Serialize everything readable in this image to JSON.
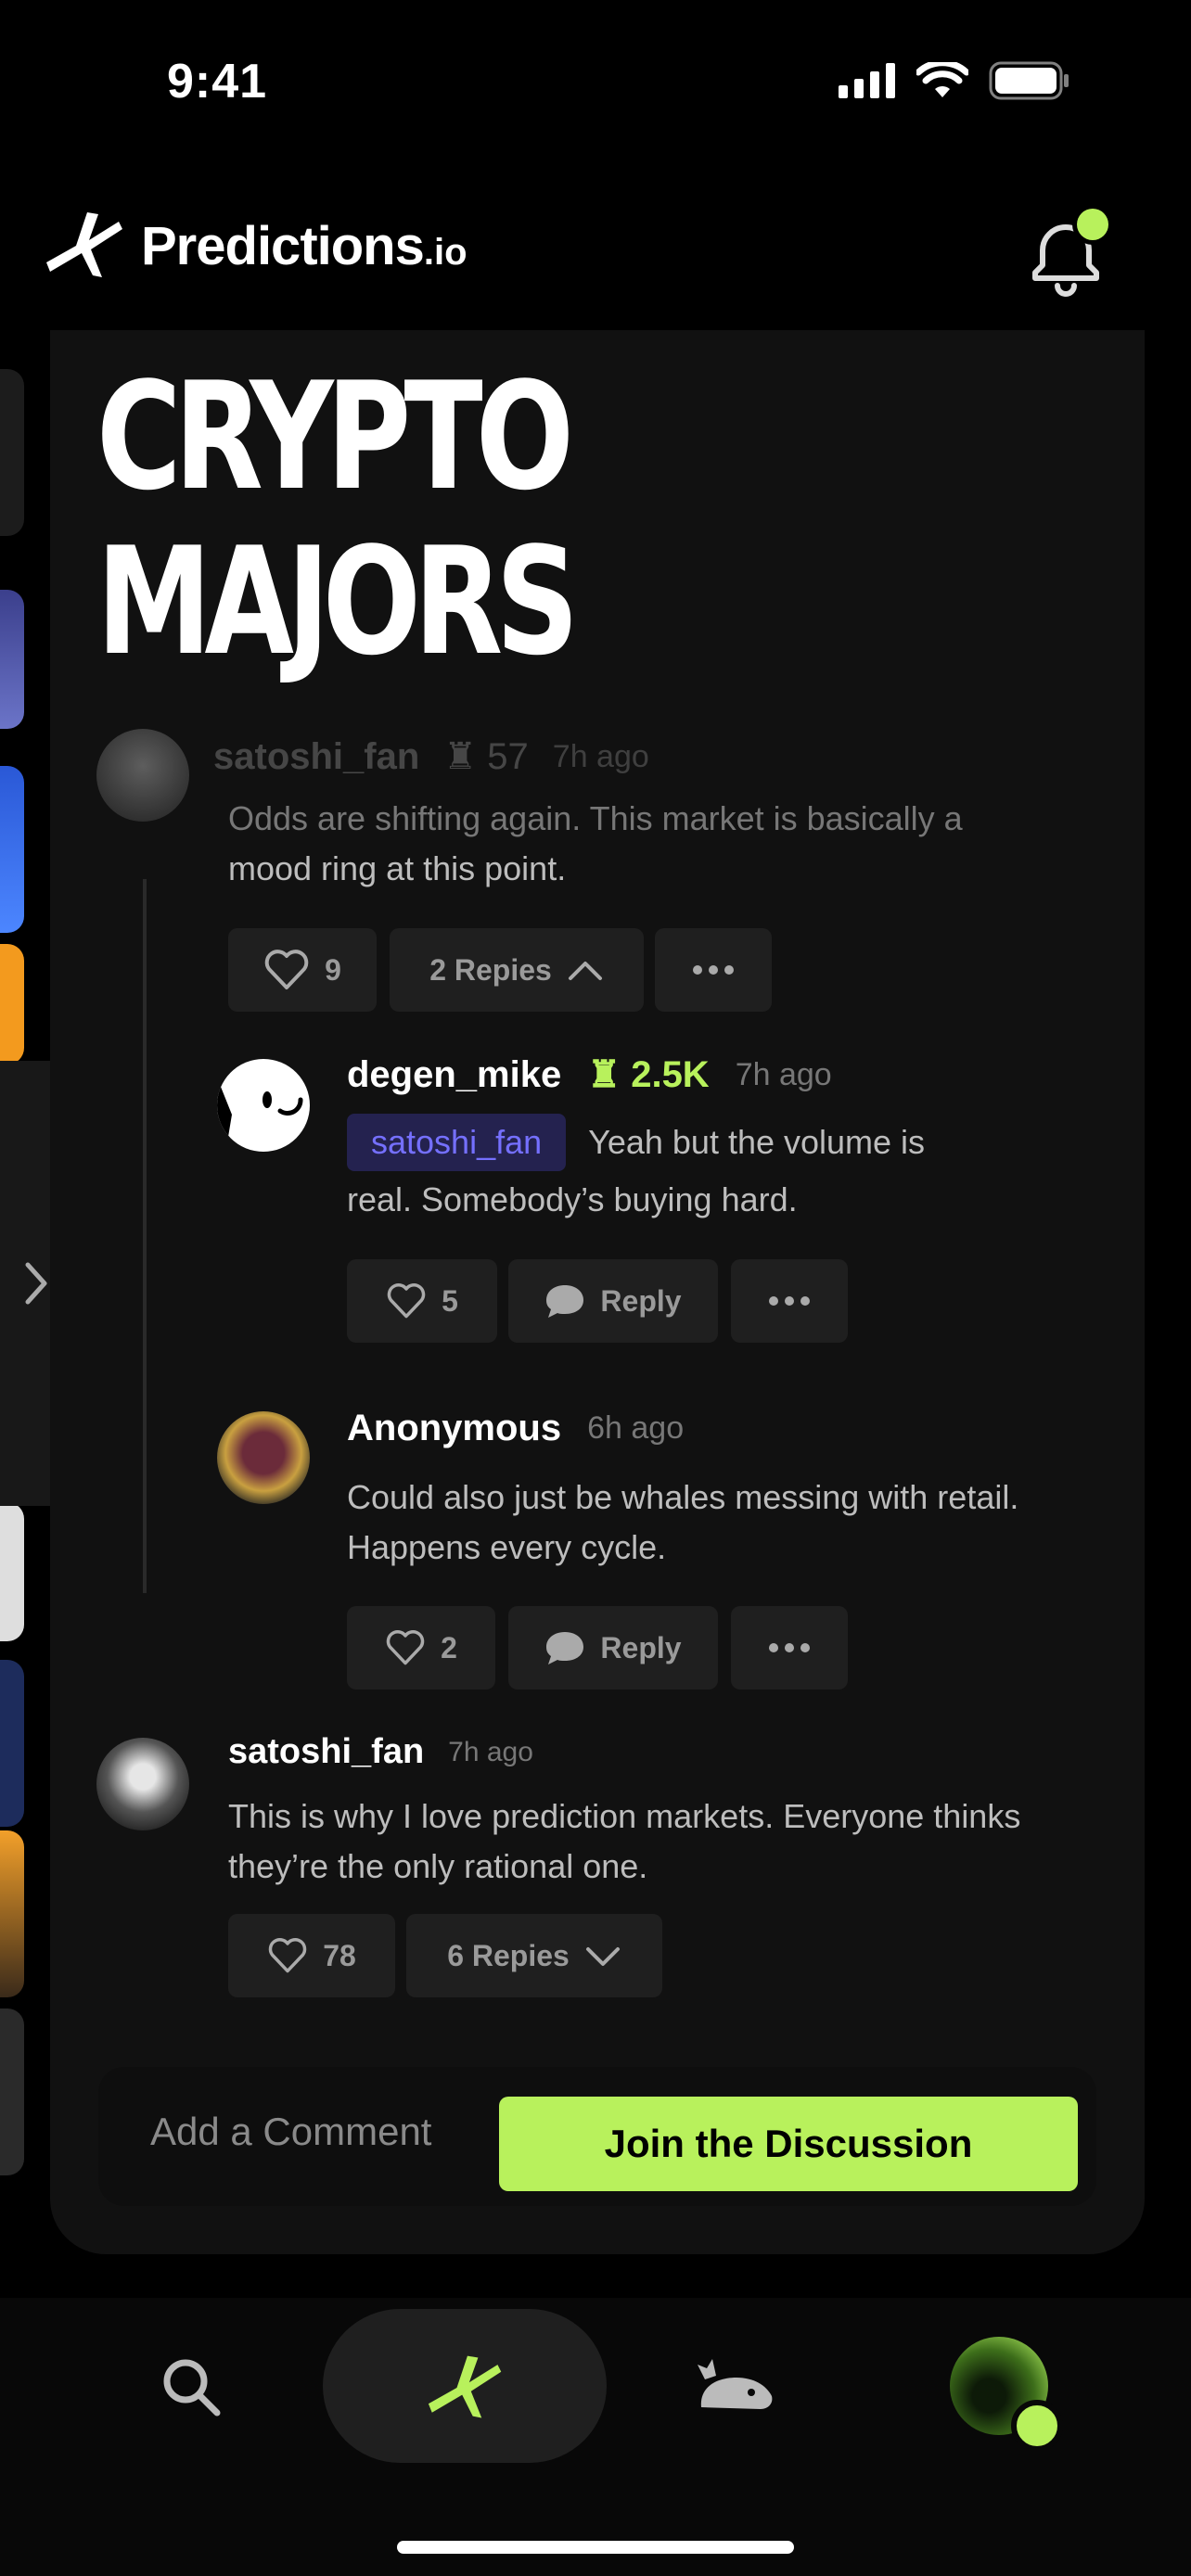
{
  "status_bar": {
    "time": "9:41"
  },
  "header": {
    "brand_name": "Predictions",
    "brand_suffix": ".io"
  },
  "page": {
    "title_line1": "CRYPTO",
    "title_line2": "MAJORS"
  },
  "comments": {
    "top_faded": {
      "user": "satoshi_fan",
      "rank": "57",
      "time": "7h ago",
      "body_line1": "Odds are shifting again. This market is basically a",
      "body_line2": "mood ring at this point.",
      "likes": "9",
      "replies_label": "2 Repies"
    },
    "reply1": {
      "user": "degen_mike",
      "rank": "2.5K",
      "time": "7h ago",
      "mention": "satoshi_fan",
      "body_line1": "Yeah but the volume is",
      "body_line2": "real. Somebody’s buying hard.",
      "likes": "5",
      "reply_label": "Reply"
    },
    "reply2": {
      "user": "Anonymous",
      "time": "6h ago",
      "body_line1": "Could also just be whales messing with retail.",
      "body_line2": "Happens every cycle.",
      "likes": "2",
      "reply_label": "Reply"
    },
    "bottom": {
      "user": "satoshi_fan",
      "time": "7h ago",
      "body_line1": "This is why I love prediction markets. Everyone thinks",
      "body_line2": "they’re the only rational one.",
      "likes": "78",
      "replies_label": "6 Repies"
    }
  },
  "composer": {
    "placeholder": "Add a Comment",
    "join_label": "Join the Discussion"
  },
  "colors": {
    "accent": "#b8f15c",
    "mention_bg": "#24224f",
    "mention_text": "#7570ff",
    "card_bg": "#111111"
  },
  "icons": [
    "signal-icon",
    "wifi-icon",
    "battery-icon",
    "bell-icon",
    "heart-icon",
    "chevron-up-icon",
    "chevron-down-icon",
    "more-icon",
    "chat-icon",
    "rank-icon",
    "search-icon",
    "home-logo-icon",
    "whale-icon",
    "chevron-right-icon"
  ]
}
